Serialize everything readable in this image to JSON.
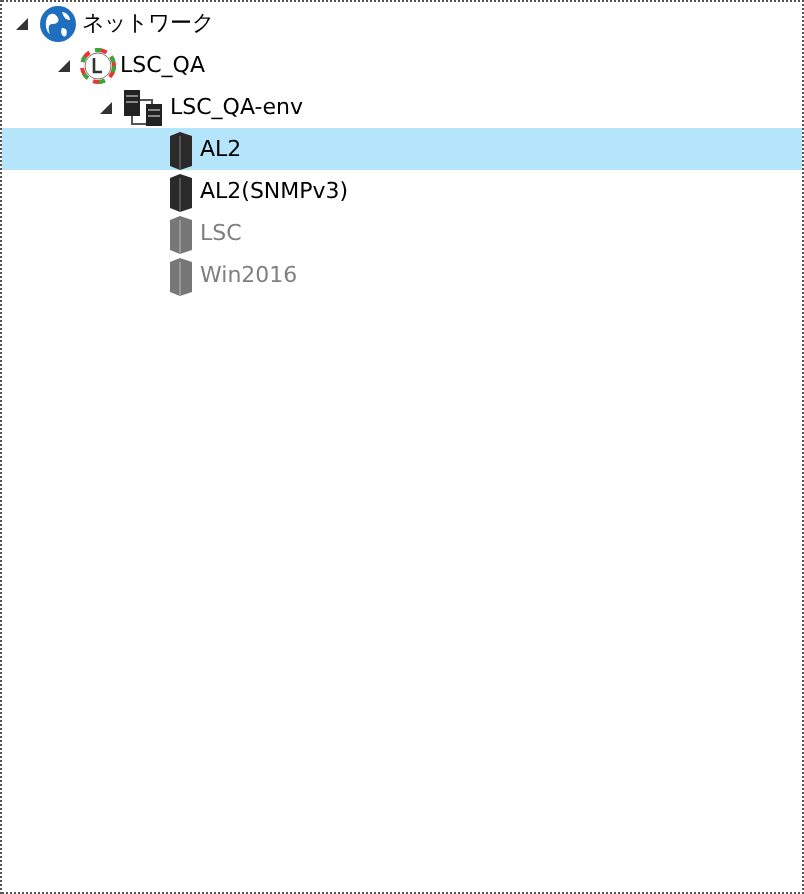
{
  "tree": [
    {
      "label": "ネットワーク",
      "kind": "network",
      "expanded": true,
      "selected": false,
      "disabled": false,
      "children": [
        {
          "label": "LSC_QA",
          "kind": "site",
          "expanded": true,
          "selected": false,
          "disabled": false,
          "children": [
            {
              "label": "LSC_QA-env",
              "kind": "group",
              "expanded": true,
              "selected": false,
              "disabled": false,
              "children": [
                {
                  "label": "AL2",
                  "kind": "server",
                  "selected": true,
                  "disabled": false
                },
                {
                  "label": "AL2(SNMPv3)",
                  "kind": "server",
                  "selected": false,
                  "disabled": false
                },
                {
                  "label": "LSC",
                  "kind": "server",
                  "selected": false,
                  "disabled": true
                },
                {
                  "label": "Win2016",
                  "kind": "server",
                  "selected": false,
                  "disabled": true
                }
              ]
            }
          ]
        }
      ]
    }
  ]
}
